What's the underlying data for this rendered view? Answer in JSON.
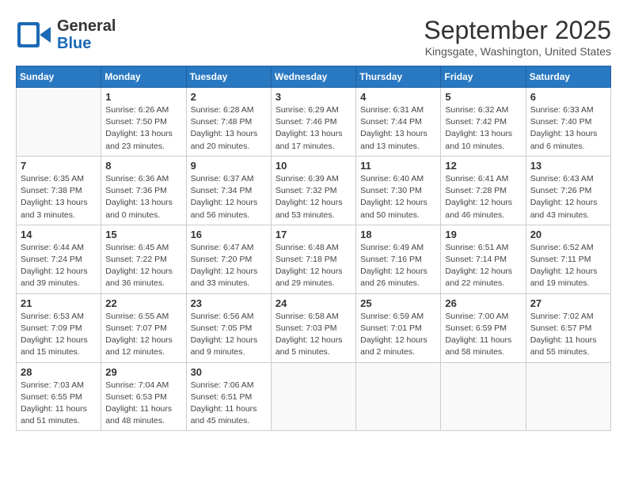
{
  "header": {
    "logo_line1": "General",
    "logo_line2": "Blue",
    "month": "September 2025",
    "location": "Kingsgate, Washington, United States"
  },
  "weekdays": [
    "Sunday",
    "Monday",
    "Tuesday",
    "Wednesday",
    "Thursday",
    "Friday",
    "Saturday"
  ],
  "weeks": [
    [
      {
        "day": "",
        "info": ""
      },
      {
        "day": "1",
        "info": "Sunrise: 6:26 AM\nSunset: 7:50 PM\nDaylight: 13 hours\nand 23 minutes."
      },
      {
        "day": "2",
        "info": "Sunrise: 6:28 AM\nSunset: 7:48 PM\nDaylight: 13 hours\nand 20 minutes."
      },
      {
        "day": "3",
        "info": "Sunrise: 6:29 AM\nSunset: 7:46 PM\nDaylight: 13 hours\nand 17 minutes."
      },
      {
        "day": "4",
        "info": "Sunrise: 6:31 AM\nSunset: 7:44 PM\nDaylight: 13 hours\nand 13 minutes."
      },
      {
        "day": "5",
        "info": "Sunrise: 6:32 AM\nSunset: 7:42 PM\nDaylight: 13 hours\nand 10 minutes."
      },
      {
        "day": "6",
        "info": "Sunrise: 6:33 AM\nSunset: 7:40 PM\nDaylight: 13 hours\nand 6 minutes."
      }
    ],
    [
      {
        "day": "7",
        "info": "Sunrise: 6:35 AM\nSunset: 7:38 PM\nDaylight: 13 hours\nand 3 minutes."
      },
      {
        "day": "8",
        "info": "Sunrise: 6:36 AM\nSunset: 7:36 PM\nDaylight: 13 hours\nand 0 minutes."
      },
      {
        "day": "9",
        "info": "Sunrise: 6:37 AM\nSunset: 7:34 PM\nDaylight: 12 hours\nand 56 minutes."
      },
      {
        "day": "10",
        "info": "Sunrise: 6:39 AM\nSunset: 7:32 PM\nDaylight: 12 hours\nand 53 minutes."
      },
      {
        "day": "11",
        "info": "Sunrise: 6:40 AM\nSunset: 7:30 PM\nDaylight: 12 hours\nand 50 minutes."
      },
      {
        "day": "12",
        "info": "Sunrise: 6:41 AM\nSunset: 7:28 PM\nDaylight: 12 hours\nand 46 minutes."
      },
      {
        "day": "13",
        "info": "Sunrise: 6:43 AM\nSunset: 7:26 PM\nDaylight: 12 hours\nand 43 minutes."
      }
    ],
    [
      {
        "day": "14",
        "info": "Sunrise: 6:44 AM\nSunset: 7:24 PM\nDaylight: 12 hours\nand 39 minutes."
      },
      {
        "day": "15",
        "info": "Sunrise: 6:45 AM\nSunset: 7:22 PM\nDaylight: 12 hours\nand 36 minutes."
      },
      {
        "day": "16",
        "info": "Sunrise: 6:47 AM\nSunset: 7:20 PM\nDaylight: 12 hours\nand 33 minutes."
      },
      {
        "day": "17",
        "info": "Sunrise: 6:48 AM\nSunset: 7:18 PM\nDaylight: 12 hours\nand 29 minutes."
      },
      {
        "day": "18",
        "info": "Sunrise: 6:49 AM\nSunset: 7:16 PM\nDaylight: 12 hours\nand 26 minutes."
      },
      {
        "day": "19",
        "info": "Sunrise: 6:51 AM\nSunset: 7:14 PM\nDaylight: 12 hours\nand 22 minutes."
      },
      {
        "day": "20",
        "info": "Sunrise: 6:52 AM\nSunset: 7:11 PM\nDaylight: 12 hours\nand 19 minutes."
      }
    ],
    [
      {
        "day": "21",
        "info": "Sunrise: 6:53 AM\nSunset: 7:09 PM\nDaylight: 12 hours\nand 15 minutes."
      },
      {
        "day": "22",
        "info": "Sunrise: 6:55 AM\nSunset: 7:07 PM\nDaylight: 12 hours\nand 12 minutes."
      },
      {
        "day": "23",
        "info": "Sunrise: 6:56 AM\nSunset: 7:05 PM\nDaylight: 12 hours\nand 9 minutes."
      },
      {
        "day": "24",
        "info": "Sunrise: 6:58 AM\nSunset: 7:03 PM\nDaylight: 12 hours\nand 5 minutes."
      },
      {
        "day": "25",
        "info": "Sunrise: 6:59 AM\nSunset: 7:01 PM\nDaylight: 12 hours\nand 2 minutes."
      },
      {
        "day": "26",
        "info": "Sunrise: 7:00 AM\nSunset: 6:59 PM\nDaylight: 11 hours\nand 58 minutes."
      },
      {
        "day": "27",
        "info": "Sunrise: 7:02 AM\nSunset: 6:57 PM\nDaylight: 11 hours\nand 55 minutes."
      }
    ],
    [
      {
        "day": "28",
        "info": "Sunrise: 7:03 AM\nSunset: 6:55 PM\nDaylight: 11 hours\nand 51 minutes."
      },
      {
        "day": "29",
        "info": "Sunrise: 7:04 AM\nSunset: 6:53 PM\nDaylight: 11 hours\nand 48 minutes."
      },
      {
        "day": "30",
        "info": "Sunrise: 7:06 AM\nSunset: 6:51 PM\nDaylight: 11 hours\nand 45 minutes."
      },
      {
        "day": "",
        "info": ""
      },
      {
        "day": "",
        "info": ""
      },
      {
        "day": "",
        "info": ""
      },
      {
        "day": "",
        "info": ""
      }
    ]
  ]
}
